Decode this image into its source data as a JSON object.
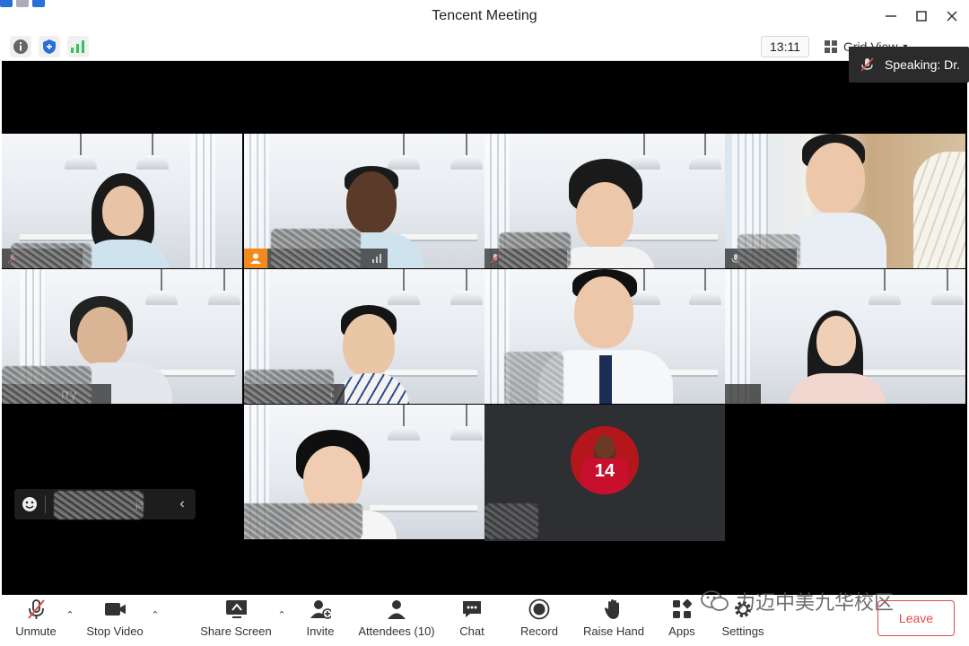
{
  "window": {
    "title": "Tencent Meeting",
    "minimize_icon": "minimize-icon",
    "maximize_icon": "maximize-icon",
    "close_icon": "close-icon"
  },
  "statusbar": {
    "time": "13:11",
    "view_label": "Grid View",
    "signal_color": "#2ec45a",
    "shield_color": "#2a6fd6"
  },
  "speaking": {
    "text": "Speaking: Dr."
  },
  "tiles": [
    {
      "name": "",
      "muted": true
    },
    {
      "name": "",
      "active": true
    },
    {
      "name": "",
      "muted": true
    },
    {
      "name": "",
      "muted": false
    },
    {
      "name": "rry"
    },
    {
      "name": "i"
    },
    {
      "name": ""
    },
    {
      "name": ""
    },
    {
      "name": ""
    },
    {
      "name": "",
      "avatar_text": "14"
    }
  ],
  "collapsed_list": {
    "name": "ja"
  },
  "toolbar": {
    "unmute": "Unmute",
    "stop_video": "Stop Video",
    "share_screen": "Share Screen",
    "invite": "Invite",
    "attendees": "Attendees (10)",
    "chat": "Chat",
    "record": "Record",
    "raise_hand": "Raise Hand",
    "apps": "Apps",
    "settings": "Settings",
    "leave": "Leave"
  },
  "watermark": {
    "text": "力迈中美九华校区"
  }
}
